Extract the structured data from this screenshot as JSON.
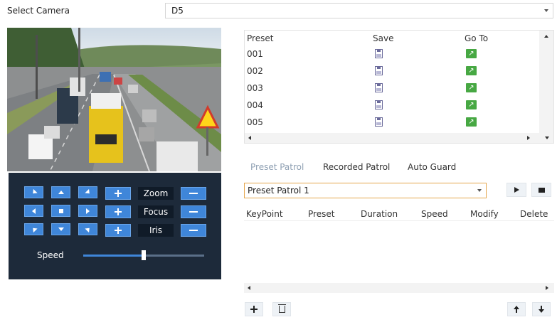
{
  "camera": {
    "label": "Select Camera",
    "selected": "D5"
  },
  "ptz": {
    "zoom_label": "Zoom",
    "focus_label": "Focus",
    "iris_label": "Iris",
    "speed_label": "Speed",
    "speed_level": 0.5
  },
  "presets": {
    "headers": {
      "preset": "Preset",
      "save": "Save",
      "goto": "Go To"
    },
    "rows": [
      {
        "num": "001"
      },
      {
        "num": "002"
      },
      {
        "num": "003"
      },
      {
        "num": "004"
      },
      {
        "num": "005"
      }
    ]
  },
  "tabs": [
    {
      "label": "Preset Patrol",
      "active": true
    },
    {
      "label": "Recorded Patrol",
      "active": false
    },
    {
      "label": "Auto Guard",
      "active": false
    }
  ],
  "patrol": {
    "selected": "Preset Patrol 1",
    "headers": {
      "keypoint": "KeyPoint",
      "preset": "Preset",
      "duration": "Duration",
      "speed": "Speed",
      "modify": "Modify",
      "delete": "Delete"
    }
  },
  "icons": {
    "save": "floppy-disk-icon",
    "goto": "arrow-goto-icon",
    "play": "play-icon",
    "stop": "stop-icon",
    "add": "plus-icon",
    "delete": "trash-icon",
    "move_up": "arrow-up-icon",
    "move_down": "arrow-down-icon"
  },
  "colors": {
    "ptz_panel": "#1d2a3a",
    "ptz_button": "#3f86d9",
    "goto_green": "#47a843",
    "select_focus": "#e4a64c"
  }
}
